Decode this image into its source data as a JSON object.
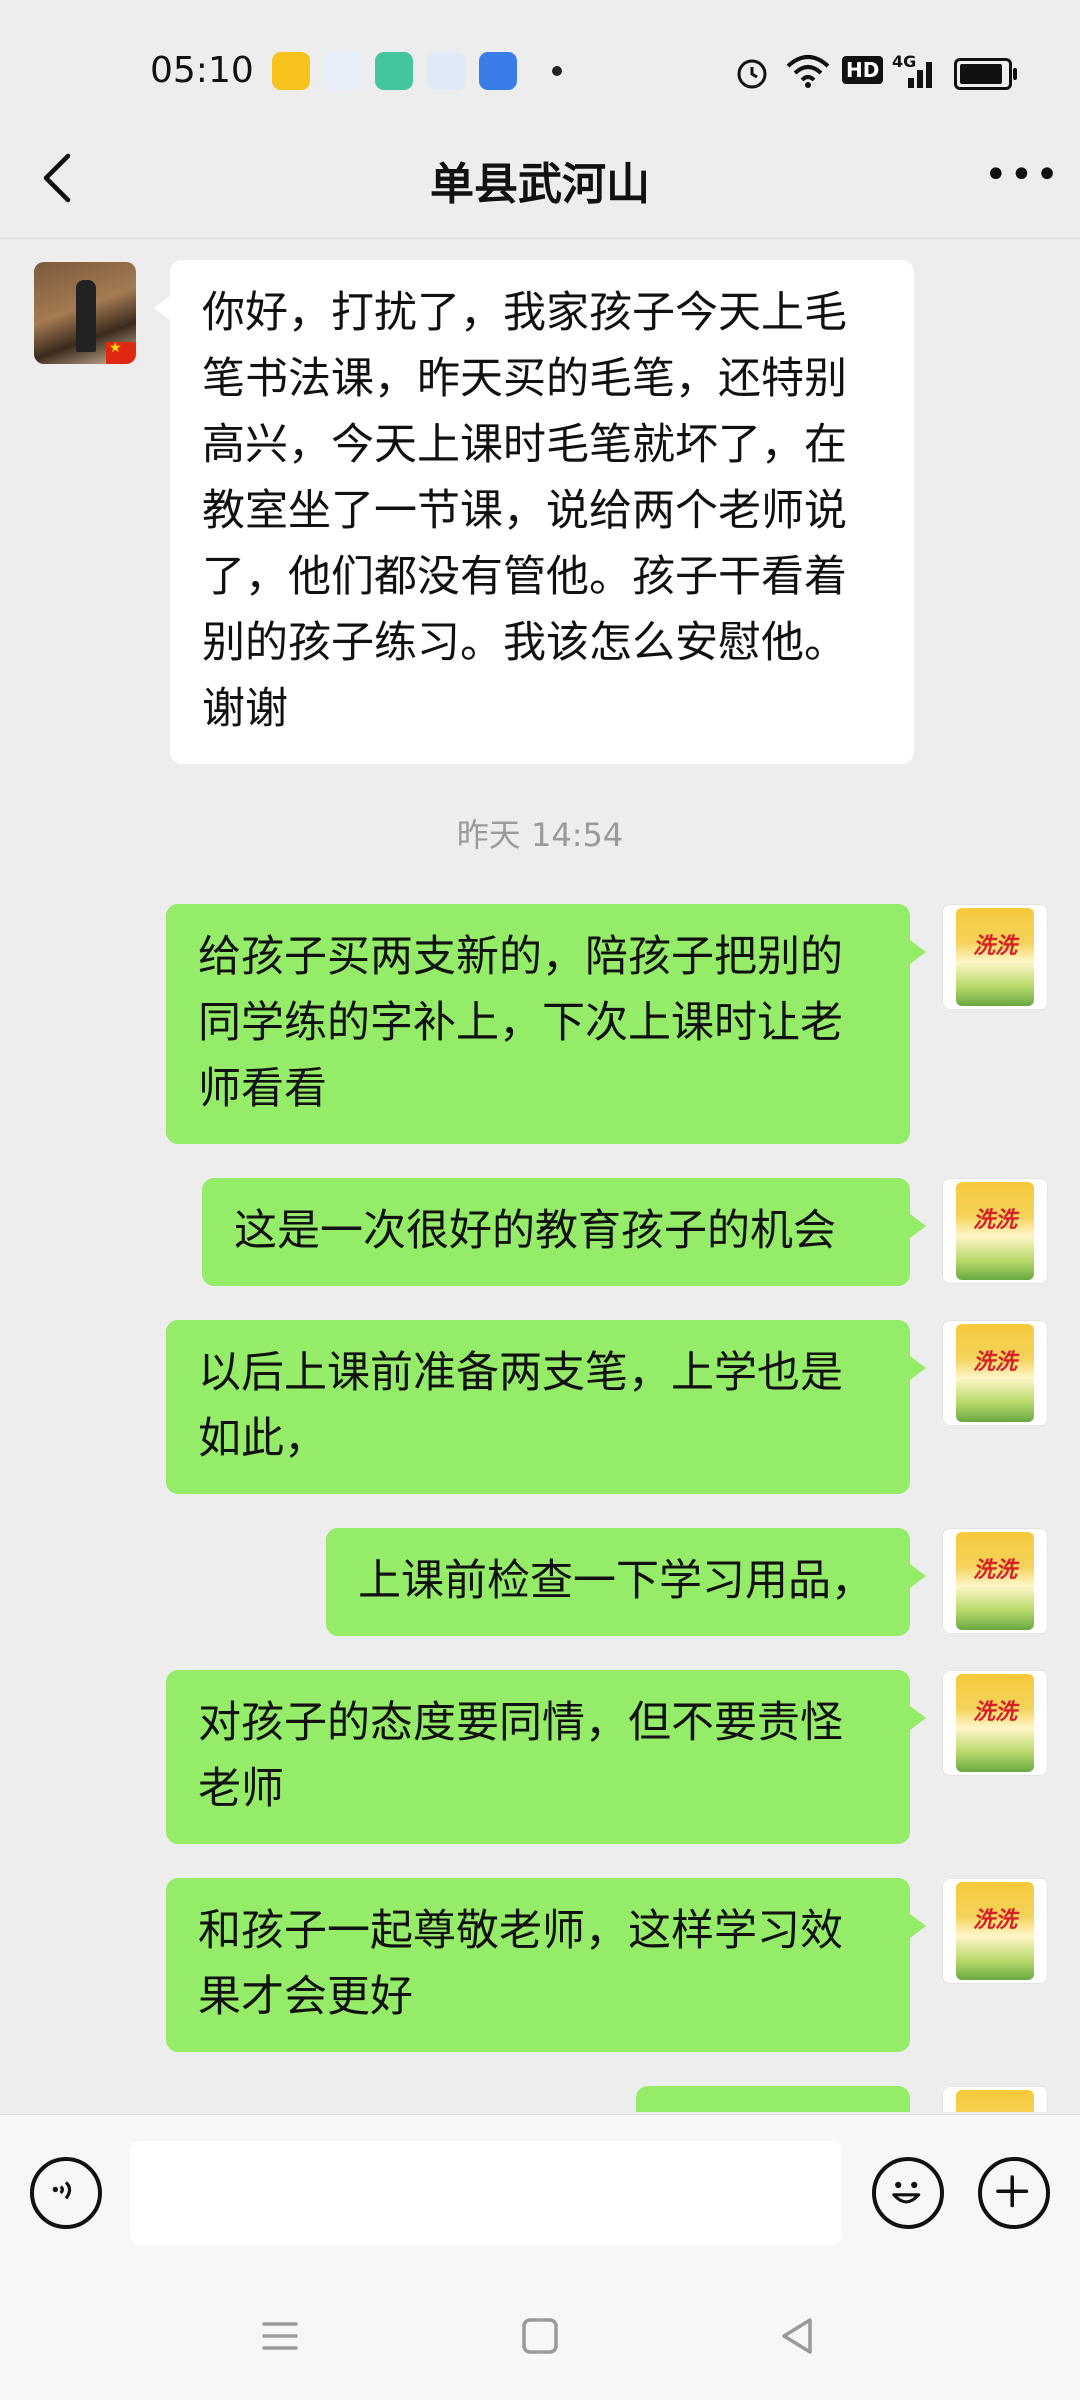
{
  "status_bar": {
    "time": "05:10",
    "hd_label": "HD",
    "network_label": "4G"
  },
  "header": {
    "title": "单县武河山"
  },
  "messages": [
    {
      "side": "in",
      "text": "你好，打扰了，我家孩子今天上毛笔书法课，昨天买的毛笔，还特别高兴，今天上课时毛笔就坏了，在教室坐了一节课，说给两个老师说了，他们都没有管他。孩子干看着别的孩子练习。我该怎么安慰他。谢谢"
    },
    {
      "side": "out",
      "text": "给孩子买两支新的，陪孩子把别的同学练的字补上，下次上课时让老师看看"
    },
    {
      "side": "out",
      "text": "这是一次很好的教育孩子的机会"
    },
    {
      "side": "out",
      "text": "以后上课前准备两支笔，上学也是如此，"
    },
    {
      "side": "out",
      "text": "上课前检查一下学习用品，"
    },
    {
      "side": "out",
      "text": "对孩子的态度要同情，但不要责怪老师"
    },
    {
      "side": "out",
      "text": "和孩子一起尊敬老师，这样学习效果才会更好"
    }
  ],
  "timestamp": "昨天 14:54",
  "avatar_brand": "洗洗",
  "input": {
    "placeholder": ""
  },
  "colors": {
    "background": "#ededed",
    "outgoing_bubble": "#95ec69",
    "incoming_bubble": "#ffffff"
  },
  "icons": [
    "back-arrow-icon",
    "more-options-icon",
    "voice-icon",
    "emoji-icon",
    "plus-icon",
    "nav-menu-icon",
    "nav-home-icon",
    "nav-back-icon"
  ]
}
